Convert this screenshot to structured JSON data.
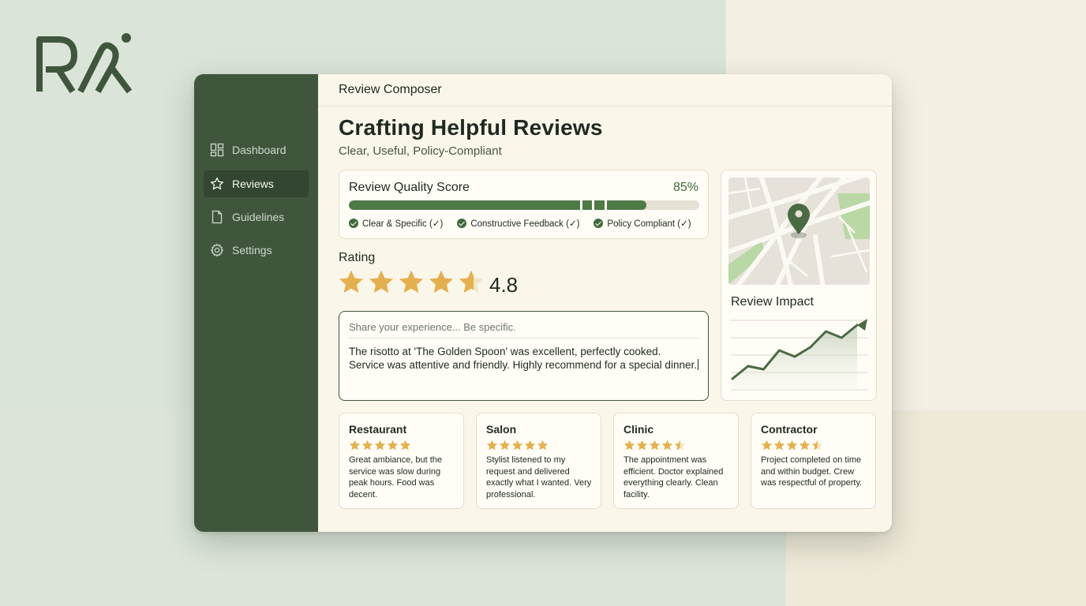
{
  "brand": {
    "logo_text": "RA",
    "accent": "#3f563d",
    "star_color": "#e4b04f"
  },
  "sidebar": {
    "items": [
      {
        "label": "Dashboard",
        "icon": "dashboard-icon",
        "active": false
      },
      {
        "label": "Reviews",
        "icon": "star-icon",
        "active": true
      },
      {
        "label": "Guidelines",
        "icon": "document-icon",
        "active": false
      },
      {
        "label": "Settings",
        "icon": "gear-icon",
        "active": false
      }
    ]
  },
  "header": {
    "title": "Review Composer"
  },
  "page": {
    "title": "Crafting Helpful Reviews",
    "subtitle": "Clear, Useful, Policy-Compliant"
  },
  "quality": {
    "title": "Review Quality Score",
    "percent_label": "85%",
    "value": 0.85,
    "checks": [
      "Clear & Specific (✓)",
      "Constructive Feedback (✓)",
      "Policy Compliant (✓)"
    ]
  },
  "rating": {
    "label": "Rating",
    "value_label": "4.8",
    "value": 4.8,
    "max": 5
  },
  "review": {
    "placeholder": "Share your experience... Be specific.",
    "text": "The risotto at 'The Golden Spoon' was excellent, perfectly cooked. Service was attentive and friendly. Highly recommend for a special dinner."
  },
  "impact": {
    "title": "Review Impact",
    "map_icon": "map-pin-icon",
    "trend": [
      0.1,
      0.3,
      0.25,
      0.55,
      0.45,
      0.6,
      0.85,
      0.75,
      0.95
    ]
  },
  "businesses": [
    {
      "name": "Restaurant",
      "rating": 5,
      "text": "Great ambiance, but the service was slow during peak hours. Food was decent."
    },
    {
      "name": "Salon",
      "rating": 5,
      "text": "Stylist listened to my request and delivered exactly what I wanted. Very professional."
    },
    {
      "name": "Clinic",
      "rating": 4.5,
      "text": "The appointment was efficient. Doctor explained everything clearly. Clean facility."
    },
    {
      "name": "Contractor",
      "rating": 4.5,
      "text": "Project completed on time and within budget. Crew was respectful of property."
    }
  ]
}
